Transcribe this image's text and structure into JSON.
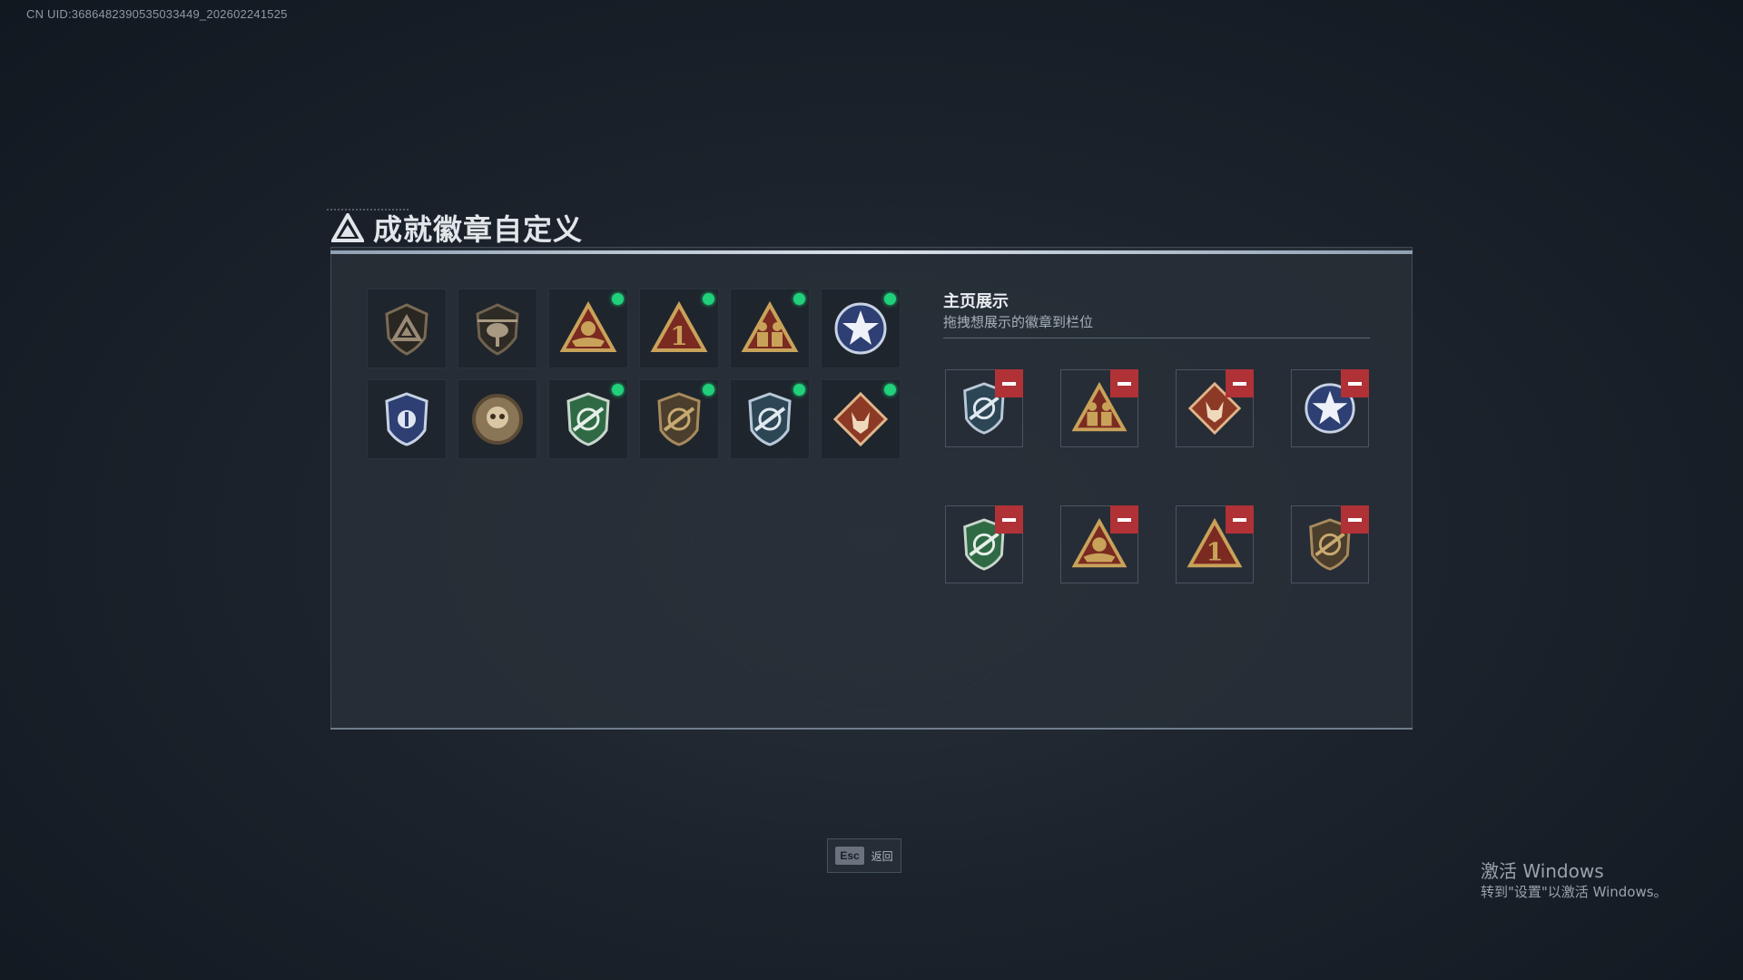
{
  "uid_text": "CN UID:3686482390535033449_202602241525",
  "title": "成就徽章自定义",
  "badge_grid": {
    "badges": [
      {
        "icon": "triangle-shield-badge-icon",
        "new": false
      },
      {
        "icon": "helicopter-badge-icon",
        "new": false
      },
      {
        "icon": "boat-triangle-badge-icon",
        "new": true
      },
      {
        "icon": "number-one-triangle-badge-icon",
        "new": true
      },
      {
        "icon": "soldiers-triangle-badge-icon",
        "new": true
      },
      {
        "icon": "star-circle-badge-icon",
        "new": true
      },
      {
        "icon": "police-shield-badge-icon",
        "new": false
      },
      {
        "icon": "skull-medallion-badge-icon",
        "new": false
      },
      {
        "icon": "green-crosshair-shield-badge-icon",
        "new": true
      },
      {
        "icon": "bronze-rifle-shield-badge-icon",
        "new": true
      },
      {
        "icon": "blue-rifle-shield-badge-icon",
        "new": true
      },
      {
        "icon": "wolf-diamond-badge-icon",
        "new": true
      }
    ]
  },
  "showcase": {
    "title": "主页展示",
    "subtitle": "拖拽想展示的徽章到栏位",
    "slots": [
      {
        "icon": "blue-rifle-shield-badge-icon"
      },
      {
        "icon": "soldiers-triangle-badge-icon"
      },
      {
        "icon": "wolf-diamond-badge-icon"
      },
      {
        "icon": "star-circle-badge-icon"
      },
      {
        "icon": "green-crosshair-shield-badge-icon"
      },
      {
        "icon": "boat-triangle-badge-icon"
      },
      {
        "icon": "number-one-triangle-badge-icon"
      },
      {
        "icon": "bronze-rifle-shield-badge-icon"
      }
    ]
  },
  "footer": {
    "esc_key": "Esc",
    "back_label": "返回"
  },
  "watermark": {
    "line1": "激活 Windows",
    "line2": "转到\"设置\"以激活 Windows。"
  },
  "colors": {
    "new_dot": "#20d07a",
    "remove_button": "#b03236",
    "gold": "#c9a25a",
    "red_brown": "#7a2a20",
    "green_shield": "#2f6a45",
    "blue_shield": "#2d3f73"
  }
}
